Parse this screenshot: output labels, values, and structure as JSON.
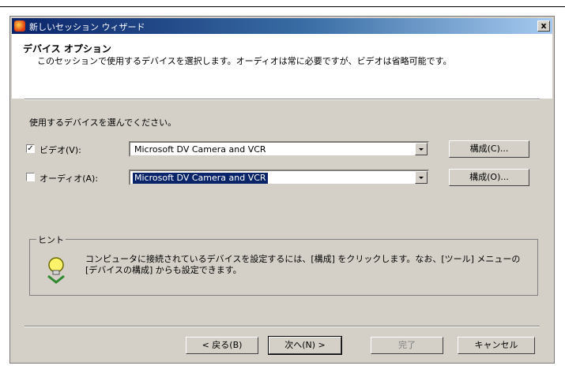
{
  "window": {
    "title": "新しいセッション ウィザード",
    "close": "x"
  },
  "header": {
    "title": "デバイス オプション",
    "description": "このセッションで使用するデバイスを選択します。オーディオは常に必要ですが、ビデオは省略可能です。"
  },
  "prompt": "使用するデバイスを選んでください。",
  "devices": [
    {
      "label": "ビデオ(V):",
      "checked": true,
      "selected": "Microsoft DV Camera and VCR",
      "config": "構成(C)..."
    },
    {
      "label": "オーディオ(A):",
      "checked": false,
      "selected": "Microsoft DV Camera and VCR",
      "config": "構成(O)..."
    }
  ],
  "hint": {
    "legend": "ヒント",
    "text": "コンピュータに接続されているデバイスを設定するには、[構成] をクリックします。なお、[ツール] メニューの [デバイスの構成] からも設定できます。"
  },
  "buttons": {
    "back": "< 戻る(B)",
    "next": "次へ(N) >",
    "finish": "完了",
    "cancel": "キャンセル"
  },
  "colors": {
    "selection": "#0a246a",
    "dialog": "#d4d0c8"
  }
}
